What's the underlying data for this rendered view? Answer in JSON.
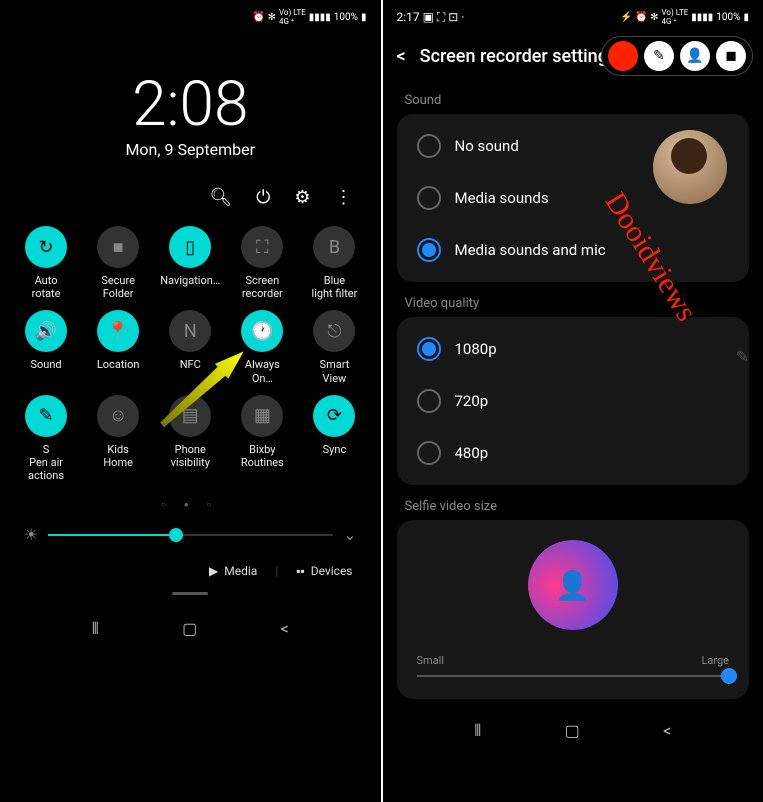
{
  "left": {
    "status": {
      "battery": "100%",
      "signal": "LTE"
    },
    "clock": {
      "time": "2:08",
      "date": "Mon, 9 September"
    },
    "toolbar": {
      "search": "search",
      "power": "power",
      "settings": "settings",
      "more": "more"
    },
    "tiles": [
      {
        "label": "Auto rotate",
        "icon": "↻",
        "on": true
      },
      {
        "label": "Secure Folder",
        "icon": "■",
        "on": false
      },
      {
        "label": "Navigation…",
        "icon": "▯",
        "on": true
      },
      {
        "label": "Screen recorder",
        "icon": "⛶",
        "on": false
      },
      {
        "label": "Blue light filter",
        "icon": "B",
        "on": false
      },
      {
        "label": "Sound",
        "icon": "🔊",
        "on": true
      },
      {
        "label": "Location",
        "icon": "📍",
        "on": true
      },
      {
        "label": "NFC",
        "icon": "N",
        "on": false
      },
      {
        "label": "Always On…",
        "icon": "🕐",
        "on": true
      },
      {
        "label": "Smart View",
        "icon": "⎋",
        "on": false
      },
      {
        "label": "S Pen air actions",
        "icon": "✎",
        "on": true
      },
      {
        "label": "Kids Home",
        "icon": "☺",
        "on": false
      },
      {
        "label": "Phone visibility",
        "icon": "▤",
        "on": false
      },
      {
        "label": "Bixby Routines",
        "icon": "▦",
        "on": false
      },
      {
        "label": "Sync",
        "icon": "⟳",
        "on": true
      }
    ],
    "footer": {
      "media": "Media",
      "devices": "Devices"
    }
  },
  "right": {
    "status": {
      "time": "2:17",
      "battery": "100%",
      "signal": "LTE"
    },
    "header": {
      "title": "Screen recorder settings"
    },
    "sections": {
      "sound": {
        "label": "Sound",
        "options": [
          {
            "label": "No sound",
            "selected": false
          },
          {
            "label": "Media sounds",
            "selected": false
          },
          {
            "label": "Media sounds and mic",
            "selected": true
          }
        ]
      },
      "quality": {
        "label": "Video quality",
        "options": [
          {
            "label": "1080p",
            "selected": true
          },
          {
            "label": "720p",
            "selected": false
          },
          {
            "label": "480p",
            "selected": false
          }
        ]
      },
      "selfie": {
        "label": "Selfie video size",
        "min": "Small",
        "max": "Large"
      }
    },
    "annotation": "Dooidviews"
  }
}
